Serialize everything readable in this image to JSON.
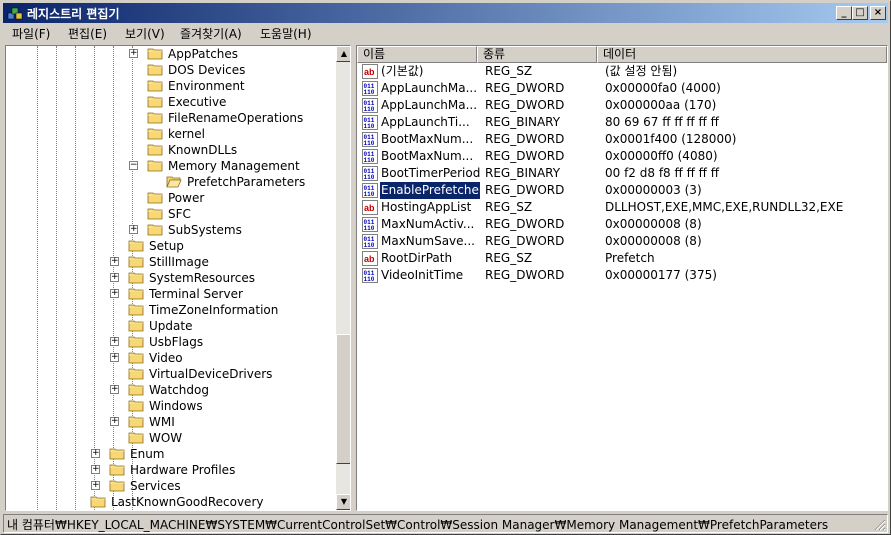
{
  "window": {
    "title": "레지스트리 편집기",
    "minimize": "_",
    "maximize": "□",
    "close": "×"
  },
  "menu": [
    "파일(F)",
    "편집(E)",
    "보기(V)",
    "즐겨찾기(A)",
    "도움말(H)"
  ],
  "tree": [
    {
      "label": "AppPatches",
      "expander": "+",
      "level": 4
    },
    {
      "label": "DOS Devices",
      "expander": "",
      "level": 4
    },
    {
      "label": "Environment",
      "expander": "",
      "level": 4
    },
    {
      "label": "Executive",
      "expander": "",
      "level": 4
    },
    {
      "label": "FileRenameOperations",
      "expander": "",
      "level": 4
    },
    {
      "label": "kernel",
      "expander": "",
      "level": 4
    },
    {
      "label": "KnownDLLs",
      "expander": "",
      "level": 4
    },
    {
      "label": "Memory Management",
      "expander": "−",
      "level": 4
    },
    {
      "label": "PrefetchParameters",
      "expander": "",
      "level": 5,
      "open": true
    },
    {
      "label": "Power",
      "expander": "",
      "level": 4
    },
    {
      "label": "SFC",
      "expander": "",
      "level": 4
    },
    {
      "label": "SubSystems",
      "expander": "+",
      "level": 4
    },
    {
      "label": "Setup",
      "expander": "",
      "level": 3
    },
    {
      "label": "StillImage",
      "expander": "+",
      "level": 3
    },
    {
      "label": "SystemResources",
      "expander": "+",
      "level": 3
    },
    {
      "label": "Terminal Server",
      "expander": "+",
      "level": 3
    },
    {
      "label": "TimeZoneInformation",
      "expander": "",
      "level": 3
    },
    {
      "label": "Update",
      "expander": "",
      "level": 3
    },
    {
      "label": "UsbFlags",
      "expander": "+",
      "level": 3
    },
    {
      "label": "Video",
      "expander": "+",
      "level": 3
    },
    {
      "label": "VirtualDeviceDrivers",
      "expander": "",
      "level": 3
    },
    {
      "label": "Watchdog",
      "expander": "+",
      "level": 3
    },
    {
      "label": "Windows",
      "expander": "",
      "level": 3
    },
    {
      "label": "WMI",
      "expander": "+",
      "level": 3
    },
    {
      "label": "WOW",
      "expander": "",
      "level": 3
    },
    {
      "label": "Enum",
      "expander": "+",
      "level": 2
    },
    {
      "label": "Hardware Profiles",
      "expander": "+",
      "level": 2
    },
    {
      "label": "Services",
      "expander": "+",
      "level": 2
    },
    {
      "label": "LastKnownGoodRecovery",
      "expander": "",
      "level": 1
    }
  ],
  "columns": {
    "name": "이름",
    "type": "종류",
    "data": "데이터"
  },
  "values": [
    {
      "name": "(기본값)",
      "type": "REG_SZ",
      "data": "(값 설정 안됨)",
      "icon": "string-value-icon"
    },
    {
      "name": "AppLaunchMa...",
      "type": "REG_DWORD",
      "data": "0x00000fa0 (4000)",
      "icon": "binary-value-icon"
    },
    {
      "name": "AppLaunchMa...",
      "type": "REG_DWORD",
      "data": "0x000000aa (170)",
      "icon": "binary-value-icon"
    },
    {
      "name": "AppLaunchTi...",
      "type": "REG_BINARY",
      "data": "80 69 67 ff ff ff ff ff",
      "icon": "binary-value-icon"
    },
    {
      "name": "BootMaxNum...",
      "type": "REG_DWORD",
      "data": "0x0001f400 (128000)",
      "icon": "binary-value-icon"
    },
    {
      "name": "BootMaxNum...",
      "type": "REG_DWORD",
      "data": "0x00000ff0 (4080)",
      "icon": "binary-value-icon"
    },
    {
      "name": "BootTimerPeriod",
      "type": "REG_BINARY",
      "data": "00 f2 d8 f8 ff ff ff ff",
      "icon": "binary-value-icon"
    },
    {
      "name": "EnablePrefetcher",
      "type": "REG_DWORD",
      "data": "0x00000003 (3)",
      "icon": "binary-value-icon",
      "selected": true
    },
    {
      "name": "HostingAppList",
      "type": "REG_SZ",
      "data": "DLLHOST,EXE,MMC,EXE,RUNDLL32,EXE",
      "icon": "string-value-icon"
    },
    {
      "name": "MaxNumActiv...",
      "type": "REG_DWORD",
      "data": "0x00000008 (8)",
      "icon": "binary-value-icon"
    },
    {
      "name": "MaxNumSave...",
      "type": "REG_DWORD",
      "data": "0x00000008 (8)",
      "icon": "binary-value-icon"
    },
    {
      "name": "RootDirPath",
      "type": "REG_SZ",
      "data": "Prefetch",
      "icon": "string-value-icon"
    },
    {
      "name": "VideoInitTime",
      "type": "REG_DWORD",
      "data": "0x00000177 (375)",
      "icon": "binary-value-icon"
    }
  ],
  "status": "내 컴퓨터₩HKEY_LOCAL_MACHINE₩SYSTEM₩CurrentControlSet₩Control₩Session Manager₩Memory Management₩PrefetchParameters",
  "colors": {
    "title_start": "#0a246a",
    "title_end": "#a6caf0",
    "selection": "#0a246a",
    "folder": "#f8d775"
  }
}
